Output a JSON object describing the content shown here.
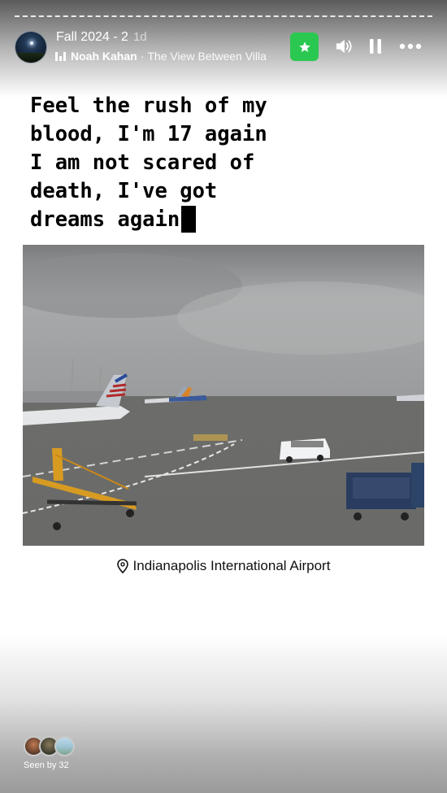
{
  "story": {
    "title": "Fall 2024 - 2",
    "time": "1d"
  },
  "music": {
    "artist": "Noah Kahan",
    "separator": "·",
    "song": "The View Between Villa"
  },
  "icons": {
    "avatar": "profile-avatar-night-sky",
    "favorite": "star-icon",
    "sound": "speaker-icon",
    "pause": "pause-icon",
    "more": "more-dots-icon",
    "location": "location-pin-icon",
    "music": "music-bars-icon"
  },
  "colors": {
    "favorite_badge": "#2bc851",
    "lyrics_text": "#000000"
  },
  "lyrics": "Feel the rush of my\nblood, I'm 17 again\nI am not scared of\ndeath, I've got\ndreams again",
  "location": {
    "name": "Indianapolis International Airport"
  },
  "viewers": {
    "seen_label": "Seen by 32"
  }
}
